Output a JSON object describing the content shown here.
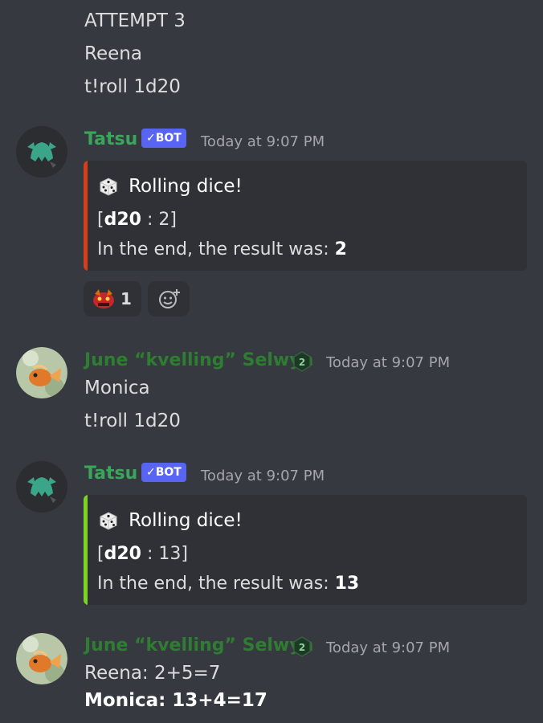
{
  "colors": {
    "background": "#36393f",
    "tatsu_name": "#3ba55c",
    "june_name": "#2e7d32",
    "embed1_bar": "#d83c1a",
    "embed2_bar": "#7ed321",
    "bot_tag": "#5865f2"
  },
  "top_lines": [
    "ATTEMPT 3",
    "Reena",
    "t!roll 1d20"
  ],
  "messages": [
    {
      "author": "Tatsu",
      "bot_tag": "✓BOT",
      "timestamp": "Today at 9:07 PM",
      "avatar_icon": "tatsu-avatar-icon",
      "embed": {
        "title": "Rolling dice!",
        "roll_label": "d20",
        "roll_value": " : 2]",
        "result_prefix": "In the end, the result was: ",
        "result_value": "2"
      },
      "reaction": {
        "icon": "red-creature-emoji-icon",
        "count": "1"
      }
    },
    {
      "author": "June “kvelling” Selwyn",
      "timestamp": "Today at 9:07 PM",
      "avatar_icon": "goldfish-avatar-icon",
      "badge_icon": "level-badge-icon",
      "lines": [
        "Monica",
        "t!roll 1d20"
      ]
    },
    {
      "author": "Tatsu",
      "bot_tag": "✓BOT",
      "timestamp": "Today at 9:07 PM",
      "avatar_icon": "tatsu-avatar-icon",
      "embed": {
        "title": "Rolling dice!",
        "roll_label": "d20",
        "roll_value": " : 13]",
        "result_prefix": "In the end, the result was: ",
        "result_value": "13"
      }
    },
    {
      "author": "June “kvelling” Selwyn",
      "timestamp": "Today at 9:07 PM",
      "avatar_icon": "goldfish-avatar-icon",
      "badge_icon": "level-badge-icon",
      "lines": [
        "Reena: 2+5=7"
      ],
      "bold_line": "Monica: 13+4=17"
    }
  ]
}
